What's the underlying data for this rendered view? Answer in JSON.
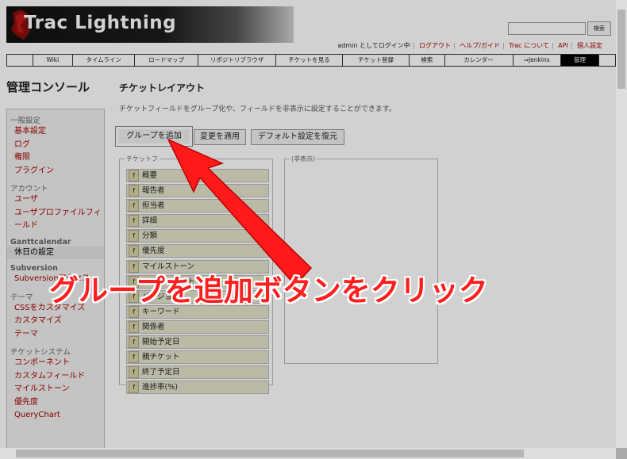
{
  "header": {
    "logo_text": "Trac Lightning",
    "search_button": "検索",
    "metanav": [
      "admin としてログイン中",
      "ログアウト",
      "ヘルプ/ガイド",
      "Trac について",
      "API",
      "個人設定"
    ]
  },
  "mainnav": [
    {
      "label": "Wiki"
    },
    {
      "label": "タイムライン"
    },
    {
      "label": "ロードマップ"
    },
    {
      "label": "リポジトリブラウザ"
    },
    {
      "label": "チケットを見る"
    },
    {
      "label": "チケット登録"
    },
    {
      "label": "検索"
    },
    {
      "label": "カレンダー"
    },
    {
      "label": "⇒Jenkins"
    },
    {
      "label": "管理"
    }
  ],
  "sidebar": {
    "title": "管理コンソール",
    "sections": [
      {
        "category": "一般設定",
        "items": [
          "基本設定",
          "ログ",
          "権限",
          "プラグイン"
        ]
      },
      {
        "category": "アカウント",
        "items": [
          "ユーザ",
          "ユーザプロファイルフィ",
          "ールド"
        ]
      },
      {
        "category": "Ganttcalendar",
        "items": [
          "休日の設定"
        ]
      },
      {
        "category": "Subversion",
        "items": [
          "Subversionアクセス"
        ]
      },
      {
        "category": "テーマ",
        "items": [
          "CSSをカスタマイズ",
          "カスタマイズ",
          "テーマ"
        ]
      },
      {
        "category": "チケットシステム",
        "items": [
          "コンポーネント",
          "カスタムフィールド",
          "マイルストーン",
          "優先度",
          "QueryChart"
        ]
      }
    ]
  },
  "content": {
    "title": "チケットレイアウト",
    "description": "チケットフィールドをグループ化や、フィールドを非表示に設定することができます。",
    "buttons": {
      "add_group": "グループを追加",
      "apply": "変更を適用",
      "reset": "デフォルト設定を復元"
    },
    "group_legend": "チケットフ",
    "hidden_legend": "(非表示)",
    "field_badge": "f",
    "fields": [
      "概要",
      "報告者",
      "担当者",
      "詳細",
      "分類",
      "優先度",
      "マイルストーン",
      "コンポーネント",
      "バージョン",
      "キーワード",
      "関係者",
      "開始予定日",
      "親チケット",
      "終了予定日",
      "進捗率(%)"
    ]
  },
  "annotation": {
    "text": "グループを追加ボタンをクリック",
    "color": "#ff1f1f"
  }
}
